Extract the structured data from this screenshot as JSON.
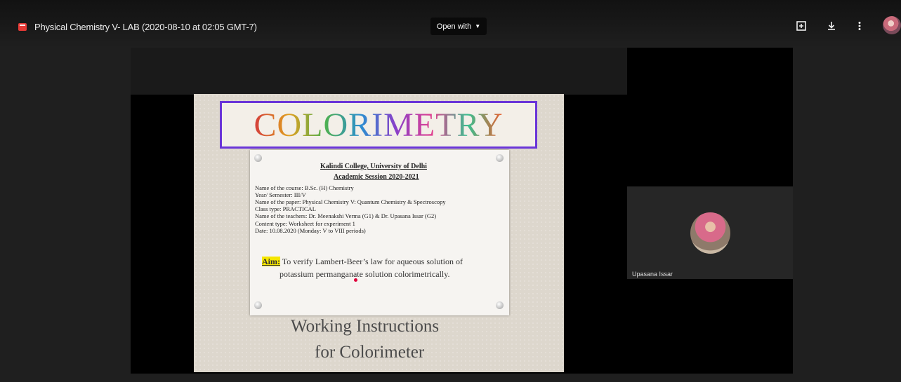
{
  "header": {
    "file_title": "Physical Chemistry V- LAB (2020-08-10 at 02:05 GMT-7)",
    "open_with_label": "Open with",
    "icons": [
      "add-comment-icon",
      "download-icon",
      "more-vert-icon"
    ]
  },
  "slide": {
    "title": "COLORIMETRY",
    "card": {
      "college": "Kalindi College, University of Delhi",
      "session": "Academic Session 2020-2021",
      "lines": [
        "Name of the course: B.Sc. (H) Chemistry",
        "Year/ Semester: III/V",
        "Name of the paper: Physical Chemistry V: Quantum Chemistry & Spectroscopy",
        "Class type: PRACTICAL",
        "Name of the teachers: Dr. Meenakshi Verma (G1) & Dr. Upasana Issar (G2)",
        "Content type: Worksheet for experiment 1",
        "Date: 10.08.2020 (Monday: V to VIII periods)"
      ],
      "aim_label": "Aim:",
      "aim_text_1": " To verify Lambert-Beer’s law for aqueous solution of",
      "aim_text_2": "potassium permanganate solution colorimetrically."
    },
    "instructions_1": "Working Instructions",
    "instructions_2": "for Colorimeter"
  },
  "participant": {
    "name": "Upasana Issar"
  }
}
